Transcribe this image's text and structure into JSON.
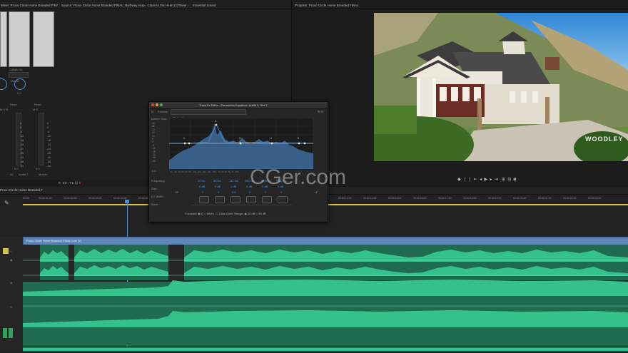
{
  "mixer": {
    "tab_title": "Mixer: Proxo Circle Home Branded FINAL",
    "track_name": "Gallalh-Yo",
    "output": "Master",
    "read1": "Read",
    "read2": "Read",
    "val1": "0.0",
    "val2": "0.0",
    "val3": "0.0",
    "val4": "0.0",
    "labels": [
      "A7",
      "Audio 7",
      "Master"
    ],
    "scale": [
      "6",
      "0",
      "-6",
      "-12",
      "-18",
      "-24",
      "-30",
      "-36",
      "-42",
      "-48",
      "-54"
    ]
  },
  "source": {
    "tab_title": "Source: Proxo Circle Home Branded FINAL: Byrhway Alop - Close to the Heart (1)Tower 4654-0036",
    "tab2": "Essential Sound"
  },
  "program": {
    "tab_title": "Program: Proxo Circle Home Branded FINAL",
    "logo": "WOODLEY"
  },
  "fx": {
    "title": "Track Fx Editor - Parametric Equalizer: Audio 2, Slot 1",
    "presets_label": "Presets:",
    "preset_value": "(Default)",
    "master_gain": "Master Gain",
    "gain_value": "0.0",
    "frequency_label": "Frequency",
    "gain_label": "Gain",
    "q_label": "Q / Width",
    "band_label": "Band",
    "freq_values": [
      "40 Hz",
      "85 Hz",
      "141 Hz",
      "282 Hz",
      "1000 Hz",
      "8000 Hz"
    ],
    "gain_values": [
      "0 dB",
      "0 dB",
      "1 dB",
      "0 dB",
      "0 dB",
      "0 dB"
    ],
    "q_values": [
      "2",
      "2",
      "0.8",
      "2",
      "2",
      "2"
    ],
    "band_numbers": [
      "1",
      "2",
      "3",
      "4",
      "5"
    ],
    "hp_label": "HP",
    "lp_label": "LP",
    "constant_label": "Constant:",
    "q_opt": "Q",
    "width_opt": "Width",
    "ultra_quiet": "Ultra-Quiet",
    "range_label": "Range:",
    "range_30": "30 dB",
    "range_96": "96 dB",
    "db_scale": [
      "dB",
      "30",
      "25",
      "20",
      "15",
      "10",
      "5",
      "0",
      "-5",
      "-10",
      "-15",
      "-20",
      "-25",
      "-30"
    ],
    "freq_scale": [
      "Hz",
      "30",
      "40",
      "50",
      "60",
      "80",
      "100",
      "200",
      "300",
      "400",
      "500",
      "1k",
      "2k",
      "3k",
      "5k",
      "7k",
      "10k",
      "20k"
    ]
  },
  "timeline": {
    "tab_title": "Proxo Circle Home Branded FINAL",
    "clip_label": "Proxo Circle Home Branded FINAL.mov [V]",
    "ticks": [
      "00:00",
      "00:00:01:00",
      "00:00:02:00",
      "00:00:03:00",
      "00:00:04:00",
      "00:00:05:00",
      "00:00:06:00",
      "00:00:07:00",
      "00:00:08:00",
      "00:00:09:00",
      "00:00:10:00",
      "00:00:11:00",
      "00:00:12:00",
      "00:00:13:00",
      "00:00:14:00",
      "00:00:15:00",
      "00:00:16:00",
      "00:00:17:00",
      "00:00:18:00",
      "00:00:19:00",
      "00:00:20:00",
      "00:00:21:00",
      "00:00:22:00",
      "00:00:23:00"
    ]
  },
  "watermark": "CGer.com"
}
